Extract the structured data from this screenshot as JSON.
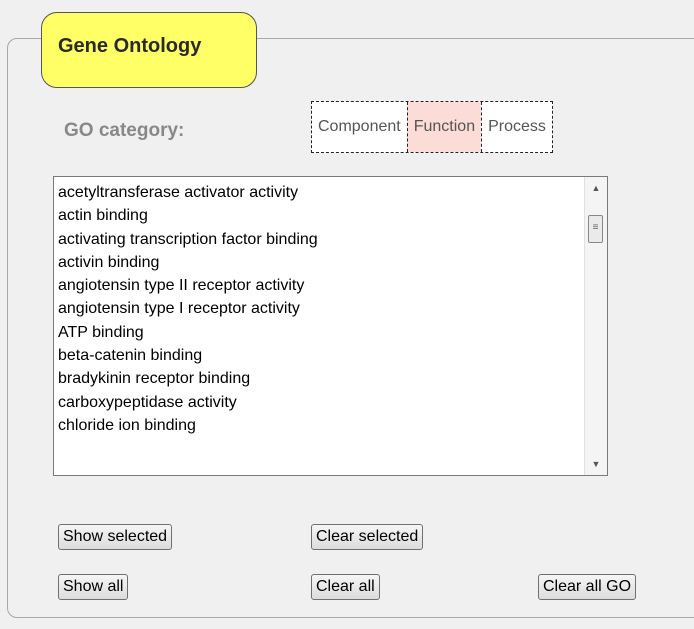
{
  "panel": {
    "title": "Gene Ontology"
  },
  "category": {
    "label": "GO category:",
    "options": [
      "Component",
      "Function",
      "Process"
    ],
    "selected": "Function"
  },
  "list": {
    "items": [
      "acetyltransferase activator activity",
      "actin binding",
      "activating transcription factor binding",
      "activin binding",
      "angiotensin type II receptor activity",
      "angiotensin type I receptor activity",
      "ATP binding",
      "beta-catenin binding",
      "bradykinin receptor binding",
      "carboxypeptidase activity",
      "chloride ion binding"
    ]
  },
  "buttons": {
    "show_selected": "Show selected",
    "clear_selected": "Clear selected",
    "show_all": "Show all",
    "clear_all": "Clear all",
    "clear_all_go": "Clear all GO"
  },
  "colors": {
    "title_bg": "#ffff66",
    "active_category_bg": "#fbdcd6"
  }
}
